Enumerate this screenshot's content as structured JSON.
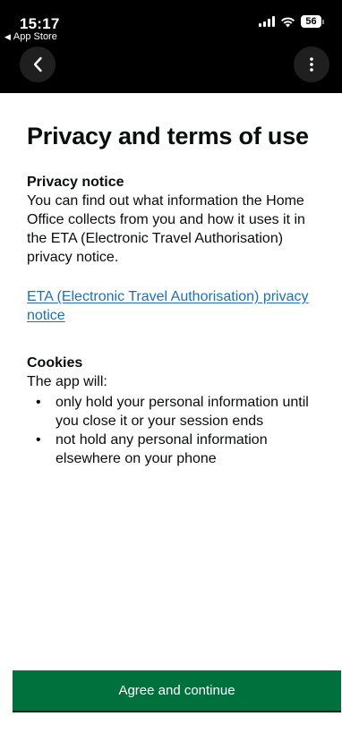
{
  "status_bar": {
    "time": "15:17",
    "back_to": "App Store",
    "battery": "56"
  },
  "page": {
    "title": "Privacy and terms of use"
  },
  "privacy_notice": {
    "heading": "Privacy notice",
    "body": "You can find out what information the Home Office collects from you and how it uses it in the ETA (Electronic Travel Authorisation) privacy notice.",
    "link": "ETA (Electronic Travel Authorisation) privacy notice"
  },
  "cookies": {
    "heading": "Cookies",
    "intro": "The app will:",
    "items": [
      "only hold your personal information until you close it or your session ends",
      "not hold any personal information elsewhere on your phone"
    ]
  },
  "actions": {
    "agree_label": "Agree and continue"
  }
}
